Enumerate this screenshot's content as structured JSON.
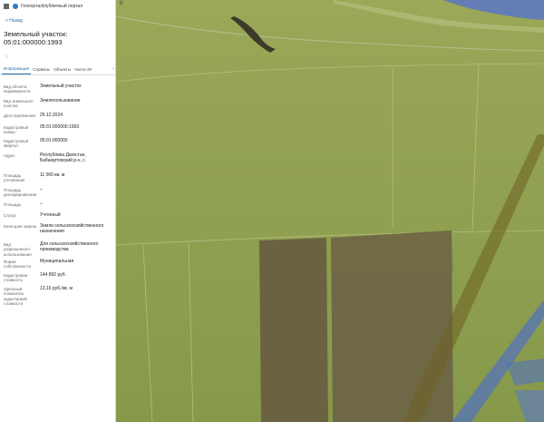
{
  "header": {
    "portal_name": "Геопортал|публичный портал"
  },
  "nav": {
    "back_label": "< Назад"
  },
  "parcel": {
    "type_title": "Земельный участок:",
    "cadastral_number": "05:01:000000:1993"
  },
  "tabs": [
    {
      "label": "Информация",
      "active": true
    },
    {
      "label": "Сервисы",
      "active": false
    },
    {
      "label": "Объекты",
      "active": false
    },
    {
      "label": "Части ЗУ",
      "active": false
    }
  ],
  "properties": [
    {
      "label": "Вид объекта недвижимости",
      "value": "Земельный участок"
    },
    {
      "label": "Вид земельного участка",
      "value": "Землепользование"
    },
    {
      "label": "Дата присвоения",
      "value": "25.12.2024"
    },
    {
      "label": "Кадастровый номер",
      "value": "05:01:000000:1993"
    },
    {
      "label": "Кадастровый квартал",
      "value": "05:01:000000"
    },
    {
      "label": "Адрес",
      "value": "Республика Дагестан, Бабаюртовский р-н, с."
    },
    {
      "label": "Площадь уточненная",
      "value": "11 000 кв. м"
    },
    {
      "label": "Площадь декларированная",
      "value": "–"
    },
    {
      "label": "Площадь",
      "value": "–"
    },
    {
      "label": "Статус",
      "value": "Учтенный"
    },
    {
      "label": "Категория земель",
      "value": "Земли сельскохозяйственного назначения"
    },
    {
      "label": "Вид разрешенного использования",
      "value": "Для сельскохозяйственного производства"
    },
    {
      "label": "Форма собственности",
      "value": "Муниципальная"
    },
    {
      "label": "Кадастровая стоимость",
      "value": "144 892 руб."
    },
    {
      "label": "Удельный показатель кадастровой стоимости",
      "value": "13,16 руб./кв. м"
    }
  ],
  "colors": {
    "field": "#8a9c4a",
    "field_light": "#a1ad5c",
    "plot_dark": "#6d6540",
    "parcel_strip": "#7a6c2a",
    "water_overlay": "#4d6dc9",
    "link": "#2a6fb0"
  }
}
